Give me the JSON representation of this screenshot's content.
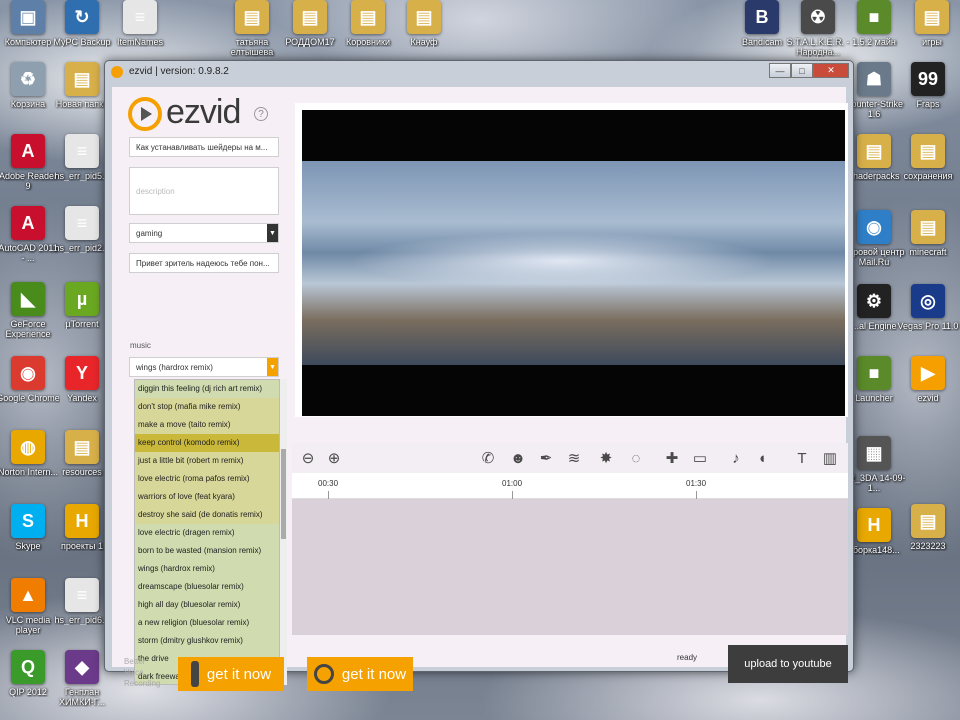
{
  "desktop": {
    "icons_left": [
      {
        "name": "computer",
        "label": "Компьютер",
        "color": "#5d7fa8",
        "glyph": "▣"
      },
      {
        "name": "recycle-bin",
        "label": "Корзина",
        "color": "#8ea0b0",
        "glyph": "♻"
      },
      {
        "name": "adobe-reader",
        "label": "Adobe Reader 9",
        "color": "#c8102e",
        "glyph": "A"
      },
      {
        "name": "autocad",
        "label": "AutoCAD 2011 - ...",
        "color": "#c8102e",
        "glyph": "A"
      },
      {
        "name": "geforce",
        "label": "GeForce Experience",
        "color": "#4a8c1c",
        "glyph": "◣"
      },
      {
        "name": "chrome",
        "label": "Google Chrome",
        "color": "#db3a2f",
        "glyph": "◉"
      },
      {
        "name": "norton",
        "label": "Norton Intern...",
        "color": "#e8a800",
        "glyph": "◍"
      },
      {
        "name": "skype",
        "label": "Skype",
        "color": "#00aff0",
        "glyph": "S"
      },
      {
        "name": "vlc",
        "label": "VLC media player",
        "color": "#f07d00",
        "glyph": "▲"
      },
      {
        "name": "qip",
        "label": "QIP 2012",
        "color": "#3a9a2a",
        "glyph": "Q"
      }
    ],
    "icons_col2": [
      {
        "name": "mypc-backup",
        "label": "MyPC Backup",
        "color": "#2f6fb0",
        "glyph": "↻"
      },
      {
        "name": "new-folder",
        "label": "Новая папка",
        "color": "#d8b04a",
        "glyph": "▤"
      },
      {
        "name": "hs-err-pid5",
        "label": "hs_err_pid5...",
        "color": "#e6e6e6",
        "glyph": "≡"
      },
      {
        "name": "hs-err-pid2",
        "label": "hs_err_pid2...",
        "color": "#e6e6e6",
        "glyph": "≡"
      },
      {
        "name": "utorrent",
        "label": "µTorrent",
        "color": "#6aa821",
        "glyph": "µ"
      },
      {
        "name": "yandex",
        "label": "Yandex",
        "color": "#e8262a",
        "glyph": "Y"
      },
      {
        "name": "resources",
        "label": "resources",
        "color": "#d8b04a",
        "glyph": "▤"
      },
      {
        "name": "projects",
        "label": "проекты 1",
        "color": "#e8a800",
        "glyph": "H"
      },
      {
        "name": "hs-err-pid6",
        "label": "hs_err_pid6...",
        "color": "#e6e6e6",
        "glyph": "≡"
      },
      {
        "name": "genplan",
        "label": "Генплан ХИМКИ-Г...",
        "color": "#6b3a8a",
        "glyph": "◆"
      }
    ],
    "icons_top": [
      {
        "name": "itemnames",
        "label": "ItemNames",
        "color": "#e6e6e6",
        "glyph": "≡"
      },
      {
        "name": "folder-tatyana",
        "label": "татьяна елтышева",
        "color": "#d8b04a",
        "glyph": "▤"
      },
      {
        "name": "folder-roddom",
        "label": "РОДДОМ17",
        "color": "#d8b04a",
        "glyph": "▤"
      },
      {
        "name": "folder-korovniki",
        "label": "Коровники",
        "color": "#d8b04a",
        "glyph": "▤"
      },
      {
        "name": "folder-knauf",
        "label": "Кнауф",
        "color": "#d8b04a",
        "glyph": "▤"
      },
      {
        "name": "bandicam",
        "label": "Bandicam",
        "color": "#2a3a6a",
        "glyph": "B"
      },
      {
        "name": "stalker",
        "label": "S.T.A.L.K.E.R. - Народна...",
        "color": "#4a4a4a",
        "glyph": "☢"
      },
      {
        "name": "minecraft-152",
        "label": "1.5.2 майн",
        "color": "#5a8a2a",
        "glyph": "■"
      },
      {
        "name": "games",
        "label": "игры",
        "color": "#d8b04a",
        "glyph": "▤"
      }
    ],
    "icons_right_col1": [
      {
        "name": "counter-strike",
        "label": "Counter-Strike 1.6",
        "color": "#6a7a8a",
        "glyph": "☗"
      },
      {
        "name": "shaderpacks",
        "label": "shaderpacks",
        "color": "#d8b04a",
        "glyph": "▤"
      },
      {
        "name": "game-center",
        "label": "Игровой центр Mail.Ru",
        "color": "#2f7fc8",
        "glyph": "◉"
      },
      {
        "name": "unity-engine",
        "label": "...al Engine",
        "color": "#222222",
        "glyph": "⚙"
      },
      {
        "name": "launcher",
        "label": "Launcher",
        "color": "#5a8a2a",
        "glyph": "■"
      },
      {
        "name": "xr-3da",
        "label": "XR_3DA 14-09-1...",
        "color": "#555555",
        "glyph": "▦"
      },
      {
        "name": "sborka",
        "label": "сборка148...",
        "color": "#e8a800",
        "glyph": "H"
      }
    ],
    "icons_right_col2": [
      {
        "name": "fraps",
        "label": "Fraps",
        "color": "#222222",
        "glyph": "99"
      },
      {
        "name": "saves",
        "label": "сохранения",
        "color": "#d8b04a",
        "glyph": "▤"
      },
      {
        "name": "minecraft",
        "label": "minecraft",
        "color": "#d8b04a",
        "glyph": "▤"
      },
      {
        "name": "vegas-pro",
        "label": "Vegas Pro 11.0",
        "color": "#1a3a8a",
        "glyph": "◎"
      },
      {
        "name": "ezvid",
        "label": "ezvid",
        "color": "#f5a000",
        "glyph": "▶"
      },
      {
        "name": "folder-2323223",
        "label": "2323223",
        "color": "#d8b04a",
        "glyph": "▤"
      }
    ]
  },
  "window": {
    "title": "ezvid | version: 0.9.8.2",
    "minimize_label": "—",
    "maximize_label": "□",
    "close_label": "✕",
    "close_color": "#c84b3c"
  },
  "sidebar": {
    "logo_text": "ezvid",
    "help_label": "?",
    "title_value": "Как устанавливать шейдеры  на м...",
    "description_placeholder": "description",
    "category_value": "gaming",
    "tags_value": "Привет зритель надеюсь тебе пон...",
    "music_label": "music",
    "music_selected": "wings (hardrox remix)",
    "music_items": [
      {
        "label": "diggin this feeling (dj rich art remix)",
        "color": "#d0dcb0"
      },
      {
        "label": "don't stop (mafia mike remix)",
        "color": "#d8d79a"
      },
      {
        "label": "make a move (taito remix)",
        "color": "#d8d79a"
      },
      {
        "label": "keep control (komodo remix)",
        "color": "#c9b83a"
      },
      {
        "label": "just a little bit (robert m remix)",
        "color": "#d8d79a"
      },
      {
        "label": "love electric (roma pafos remix)",
        "color": "#d8d79a"
      },
      {
        "label": "warriors of love (feat kyara)",
        "color": "#d8d79a"
      },
      {
        "label": "destroy she said (de donatis remix)",
        "color": "#d8d79a"
      },
      {
        "label": "love electric (dragen remix)",
        "color": "#d0dcb0"
      },
      {
        "label": "born to be wasted (mansion remix)",
        "color": "#d0dcb0"
      },
      {
        "label": "wings (hardrox remix)",
        "color": "#d0dcb0"
      },
      {
        "label": "dreamscape (bluesolar remix)",
        "color": "#d0dcb0"
      },
      {
        "label": "high all day (bluesolar remix)",
        "color": "#d0dcb0"
      },
      {
        "label": "a new religion (bluesolar remix)",
        "color": "#d0dcb0"
      },
      {
        "label": "storm (dmitry glushkov remix)",
        "color": "#d0dcb0"
      },
      {
        "label": "the drive",
        "color": "#d0dcb0"
      },
      {
        "label": "dark freeways",
        "color": "#d0dcb0"
      }
    ],
    "better_voice_lines": [
      "Better",
      "Voice",
      "Recording"
    ],
    "get_it_now_1": "get it now",
    "get_it_now_2": "get it now"
  },
  "toolbar": {
    "tools": [
      {
        "name": "zoom-out-icon",
        "glyph": "⊖"
      },
      {
        "name": "zoom-in-icon",
        "glyph": "⊕"
      },
      {
        "name": "phone-icon",
        "glyph": "✆"
      },
      {
        "name": "robot-icon",
        "glyph": "☻"
      },
      {
        "name": "pen-icon",
        "glyph": "✒"
      },
      {
        "name": "wave-icon",
        "glyph": "≋"
      },
      {
        "name": "burst-icon",
        "glyph": "✸"
      },
      {
        "name": "spiral-icon",
        "glyph": "◌"
      },
      {
        "name": "gamepad-icon",
        "glyph": "✚"
      },
      {
        "name": "monitor-icon",
        "glyph": "▭"
      },
      {
        "name": "microphone-icon",
        "glyph": "♪"
      },
      {
        "name": "speaker-icon",
        "glyph": "◖"
      },
      {
        "name": "text-icon",
        "glyph": "T"
      },
      {
        "name": "film-icon",
        "glyph": "▥"
      }
    ]
  },
  "timeline": {
    "ticks": [
      "00:30",
      "01:00",
      "01:30"
    ]
  },
  "status": {
    "ready": "ready",
    "upload_label": "upload to youtube"
  }
}
